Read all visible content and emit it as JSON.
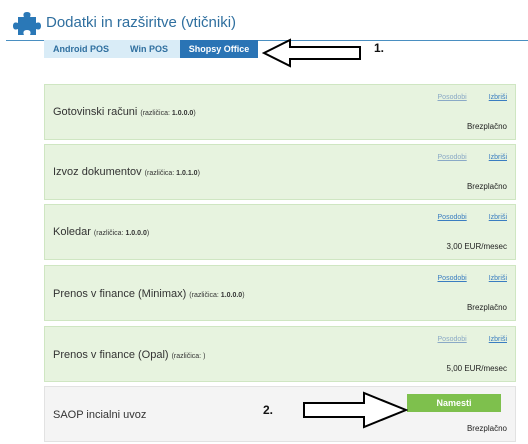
{
  "header": {
    "title": "Dodatki in razširitve (vtičniki)",
    "icon": "puzzle-icon",
    "icon_color": "#2a78b7"
  },
  "tabs": [
    {
      "label": "Android POS",
      "active": false
    },
    {
      "label": "Win POS",
      "active": false
    },
    {
      "label": "Shopsy Office",
      "active": true
    }
  ],
  "annotations": {
    "note1": "1.",
    "note2": "2."
  },
  "plugins": [
    {
      "name": "Gotovinski računi",
      "version_label": "(različica:",
      "version": "1.0.0.0",
      "version_suffix": ")",
      "link_update": "Posodobi",
      "link_delete": "Izbriši",
      "price": "Brezplačno"
    },
    {
      "name": "Izvoz dokumentov",
      "version_label": "(različica:",
      "version": "1.0.1.0",
      "version_suffix": ")",
      "link_update": "Posodobi",
      "link_delete": "Izbriši",
      "price": "Brezplačno"
    },
    {
      "name": "Koledar",
      "version_label": "(različica:",
      "version": "1.0.0.0",
      "version_suffix": ")",
      "link_update": "Posodobi",
      "link_delete": "Izbriši",
      "price": "3,00 EUR/mesec"
    },
    {
      "name": "Prenos v finance (Minimax)",
      "version_label": "(različica:",
      "version": "1.0.0.0",
      "version_suffix": ")",
      "link_update": "Posodobi",
      "link_delete": "Izbriši",
      "price": "Brezplačno"
    },
    {
      "name": "Prenos v finance (Opal)",
      "version_label": "(različica: )",
      "version": "",
      "version_suffix": "",
      "link_update": "Posodobi",
      "link_delete": "Izbriši",
      "price": "5,00 EUR/mesec"
    },
    {
      "name": "SAOP incialni uvoz",
      "install_label": "Namesti",
      "price": "Brezplačno"
    }
  ],
  "colors": {
    "accent": "#2a74b5",
    "card_green": "#e7f3df",
    "install_green": "#7ec04d"
  }
}
